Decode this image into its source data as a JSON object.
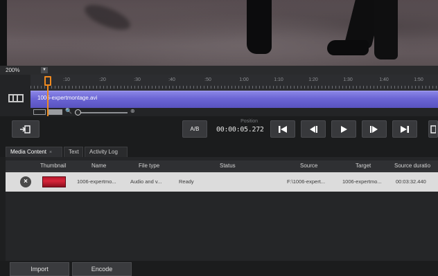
{
  "zoom": {
    "value": "200%",
    "arrow": "▼"
  },
  "timeline": {
    "ticks": [
      ":10",
      ":20",
      ":30",
      ":40",
      ":50",
      "1:00",
      "1:10",
      "1:20",
      "1:30",
      "1:40",
      "1:50"
    ],
    "clip_name": "1006-expertmontage.avi",
    "zoom_in_glyph": "⊕",
    "search_glyph": "🔍"
  },
  "transport": {
    "ab_label": "A/B",
    "position_label": "Position",
    "position_value": "00:00:05.272"
  },
  "tabs": [
    {
      "label": "Media Content",
      "close": "×"
    },
    {
      "label": "Text"
    },
    {
      "label": "Activity Log"
    }
  ],
  "table": {
    "columns": [
      "Thumbnail",
      "Name",
      "File type",
      "Status",
      "Source",
      "Target",
      "Source duratio"
    ],
    "rows": [
      {
        "remove": "×",
        "name": "1006-expertmo...",
        "file_type": "Audio and v...",
        "status": "Ready",
        "source": "F:\\1006-expert...",
        "target": "1006-expertmo...",
        "duration": "00:03:32.440"
      }
    ]
  },
  "buttons": {
    "import": "Import",
    "encode": "Encode"
  },
  "colors": {
    "accent_playhead": "#f08a1f",
    "clip": "#6a64d4",
    "row_bg": "#dcdcdc"
  }
}
